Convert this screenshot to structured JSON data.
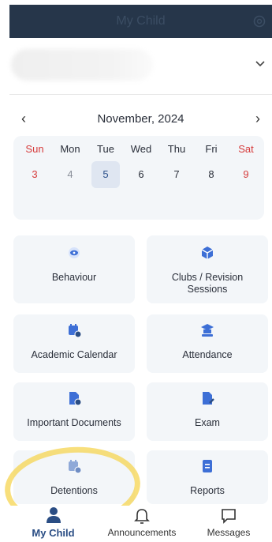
{
  "header": {
    "title": "My Child"
  },
  "calendar": {
    "month_label": "November, 2024",
    "prev": "‹",
    "next": "›",
    "weekdays": [
      "Sun",
      "Mon",
      "Tue",
      "Wed",
      "Thu",
      "Fri",
      "Sat"
    ],
    "days": [
      "3",
      "4",
      "5",
      "6",
      "7",
      "8",
      "9"
    ],
    "selected_day": "5"
  },
  "tiles": [
    {
      "label": "Behaviour",
      "icon": "eye-icon"
    },
    {
      "label": "Clubs / Revision Sessions",
      "icon": "cube-icon"
    },
    {
      "label": "Academic Calendar",
      "icon": "calendar-clock-icon"
    },
    {
      "label": "Attendance",
      "icon": "graduation-icon"
    },
    {
      "label": "Important Documents",
      "icon": "document-info-icon"
    },
    {
      "label": "Exam",
      "icon": "document-edit-icon"
    },
    {
      "label": "Detentions",
      "icon": "calendar-info-icon"
    },
    {
      "label": "Reports",
      "icon": "report-icon"
    }
  ],
  "bottom_nav": {
    "my_child": "My Child",
    "announcements": "Announcements",
    "messages": "Messages"
  },
  "colors": {
    "header_bg": "#26364a",
    "accent": "#2a4d84",
    "icon_blue": "#3d6fd6",
    "weekend_red": "#d63b3b",
    "tile_bg": "#f3f6f9",
    "highlight": "#f5d450"
  }
}
